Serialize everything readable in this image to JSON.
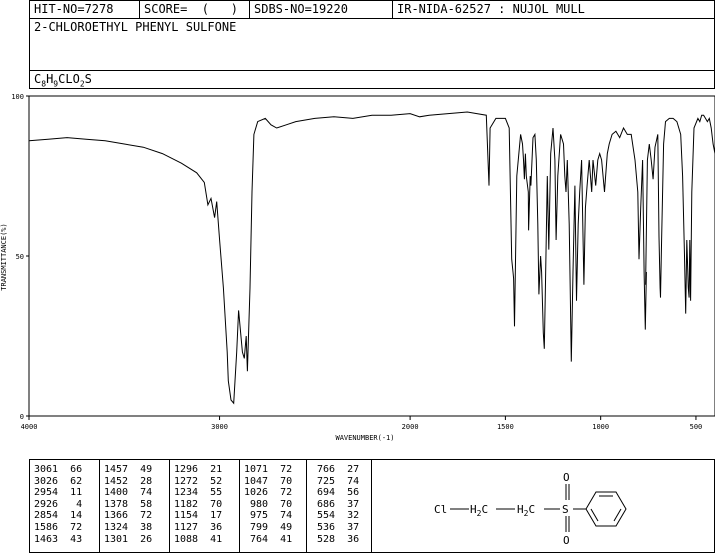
{
  "header": {
    "hit_no": "HIT-NO=7278",
    "score": "SCORE=  (   )",
    "sdbs_no": "SDBS-NO=19220",
    "ir_nida": "IR-NIDA-62527 : NUJOL MULL"
  },
  "compound": {
    "name": "2-CHLOROETHYL PHENYL SULFONE",
    "formula": "C8H9CLO2S"
  },
  "chart_data": {
    "type": "line",
    "xlabel": "WAVENUMBER(-1)",
    "ylabel": "TRANSMITTANCE(%)",
    "xlim": [
      4000,
      400
    ],
    "ylim": [
      0,
      100
    ],
    "xticks": [
      4000,
      3000,
      2000,
      1500,
      1000,
      500
    ],
    "yticks": [
      0,
      50,
      100
    ],
    "points": [
      [
        4000,
        86
      ],
      [
        3900,
        86.5
      ],
      [
        3800,
        87
      ],
      [
        3700,
        86.5
      ],
      [
        3600,
        86
      ],
      [
        3500,
        85
      ],
      [
        3400,
        84
      ],
      [
        3300,
        82
      ],
      [
        3200,
        79
      ],
      [
        3120,
        76
      ],
      [
        3080,
        73
      ],
      [
        3061,
        66
      ],
      [
        3045,
        68
      ],
      [
        3026,
        62
      ],
      [
        3015,
        67
      ],
      [
        3000,
        55
      ],
      [
        2980,
        40
      ],
      [
        2960,
        20
      ],
      [
        2954,
        11
      ],
      [
        2940,
        5
      ],
      [
        2926,
        4
      ],
      [
        2910,
        20
      ],
      [
        2900,
        33
      ],
      [
        2880,
        20
      ],
      [
        2870,
        18
      ],
      [
        2860,
        25
      ],
      [
        2854,
        14
      ],
      [
        2840,
        40
      ],
      [
        2830,
        70
      ],
      [
        2820,
        88
      ],
      [
        2800,
        92
      ],
      [
        2760,
        93
      ],
      [
        2730,
        91
      ],
      [
        2700,
        90
      ],
      [
        2650,
        91
      ],
      [
        2600,
        92
      ],
      [
        2500,
        93
      ],
      [
        2400,
        93.5
      ],
      [
        2300,
        93
      ],
      [
        2200,
        94
      ],
      [
        2100,
        94
      ],
      [
        2000,
        94.5
      ],
      [
        1950,
        93.5
      ],
      [
        1900,
        94
      ],
      [
        1800,
        94.5
      ],
      [
        1700,
        95
      ],
      [
        1650,
        94.5
      ],
      [
        1600,
        94
      ],
      [
        1586,
        72
      ],
      [
        1580,
        90
      ],
      [
        1550,
        93
      ],
      [
        1500,
        93
      ],
      [
        1480,
        90
      ],
      [
        1467,
        49
      ],
      [
        1460,
        45
      ],
      [
        1457,
        43
      ],
      [
        1452,
        28
      ],
      [
        1440,
        75
      ],
      [
        1420,
        88
      ],
      [
        1410,
        85
      ],
      [
        1405,
        80
      ],
      [
        1400,
        74
      ],
      [
        1395,
        82
      ],
      [
        1390,
        75
      ],
      [
        1380,
        70
      ],
      [
        1378,
        58
      ],
      [
        1370,
        75
      ],
      [
        1366,
        72
      ],
      [
        1355,
        87
      ],
      [
        1345,
        88
      ],
      [
        1338,
        80
      ],
      [
        1330,
        60
      ],
      [
        1324,
        38
      ],
      [
        1315,
        50
      ],
      [
        1310,
        45
      ],
      [
        1305,
        35
      ],
      [
        1301,
        26
      ],
      [
        1296,
        21
      ],
      [
        1290,
        40
      ],
      [
        1280,
        75
      ],
      [
        1272,
        52
      ],
      [
        1262,
        82
      ],
      [
        1250,
        90
      ],
      [
        1240,
        80
      ],
      [
        1234,
        55
      ],
      [
        1225,
        75
      ],
      [
        1210,
        88
      ],
      [
        1195,
        85
      ],
      [
        1188,
        75
      ],
      [
        1182,
        70
      ],
      [
        1175,
        80
      ],
      [
        1165,
        60
      ],
      [
        1160,
        40
      ],
      [
        1154,
        17
      ],
      [
        1145,
        45
      ],
      [
        1135,
        72
      ],
      [
        1127,
        36
      ],
      [
        1118,
        60
      ],
      [
        1110,
        70
      ],
      [
        1100,
        80
      ],
      [
        1088,
        41
      ],
      [
        1080,
        65
      ],
      [
        1071,
        72
      ],
      [
        1060,
        80
      ],
      [
        1047,
        70
      ],
      [
        1040,
        80
      ],
      [
        1026,
        72
      ],
      [
        1015,
        80
      ],
      [
        1005,
        82
      ],
      [
        995,
        80
      ],
      [
        980,
        70
      ],
      [
        975,
        74
      ],
      [
        965,
        82
      ],
      [
        955,
        85
      ],
      [
        940,
        88
      ],
      [
        920,
        89
      ],
      [
        900,
        87
      ],
      [
        880,
        90
      ],
      [
        860,
        88
      ],
      [
        840,
        88
      ],
      [
        820,
        80
      ],
      [
        805,
        70
      ],
      [
        799,
        49
      ],
      [
        790,
        65
      ],
      [
        780,
        80
      ],
      [
        772,
        45
      ],
      [
        766,
        27
      ],
      [
        760,
        45
      ],
      [
        764,
        41
      ],
      [
        755,
        80
      ],
      [
        745,
        85
      ],
      [
        735,
        80
      ],
      [
        725,
        74
      ],
      [
        715,
        84
      ],
      [
        700,
        88
      ],
      [
        694,
        56
      ],
      [
        688,
        40
      ],
      [
        686,
        37
      ],
      [
        680,
        55
      ],
      [
        670,
        85
      ],
      [
        660,
        92
      ],
      [
        640,
        93
      ],
      [
        620,
        93
      ],
      [
        600,
        92
      ],
      [
        580,
        88
      ],
      [
        570,
        75
      ],
      [
        560,
        50
      ],
      [
        554,
        32
      ],
      [
        548,
        55
      ],
      [
        540,
        40
      ],
      [
        536,
        37
      ],
      [
        532,
        55
      ],
      [
        528,
        36
      ],
      [
        522,
        70
      ],
      [
        510,
        90
      ],
      [
        490,
        93
      ],
      [
        480,
        92
      ],
      [
        470,
        94
      ],
      [
        460,
        94
      ],
      [
        450,
        93
      ],
      [
        440,
        92
      ],
      [
        430,
        93
      ],
      [
        420,
        90
      ],
      [
        410,
        85
      ],
      [
        400,
        82
      ]
    ],
    "peak_table": [
      [
        [
          3061,
          66
        ],
        [
          3026,
          62
        ],
        [
          2954,
          11
        ],
        [
          2926,
          4
        ],
        [
          2854,
          14
        ],
        [
          1586,
          72
        ],
        [
          1463,
          43
        ]
      ],
      [
        [
          1457,
          49
        ],
        [
          1452,
          28
        ],
        [
          1400,
          74
        ],
        [
          1378,
          58
        ],
        [
          1366,
          72
        ],
        [
          1324,
          38
        ],
        [
          1301,
          26
        ]
      ],
      [
        [
          1296,
          21
        ],
        [
          1272,
          52
        ],
        [
          1234,
          55
        ],
        [
          1182,
          70
        ],
        [
          1154,
          17
        ],
        [
          1127,
          36
        ],
        [
          1088,
          41
        ]
      ],
      [
        [
          1071,
          72
        ],
        [
          1047,
          70
        ],
        [
          1026,
          72
        ],
        [
          980,
          70
        ],
        [
          975,
          74
        ],
        [
          799,
          49
        ],
        [
          764,
          41
        ]
      ],
      [
        [
          766,
          27
        ],
        [
          725,
          74
        ],
        [
          694,
          56
        ],
        [
          686,
          37
        ],
        [
          554,
          32
        ],
        [
          536,
          37
        ],
        [
          528,
          36
        ]
      ]
    ]
  },
  "structure": {
    "cl": "Cl",
    "ch2a": "H2C",
    "ch2b": "H2C",
    "s": "S",
    "o_top": "O",
    "o_bottom": "O"
  }
}
